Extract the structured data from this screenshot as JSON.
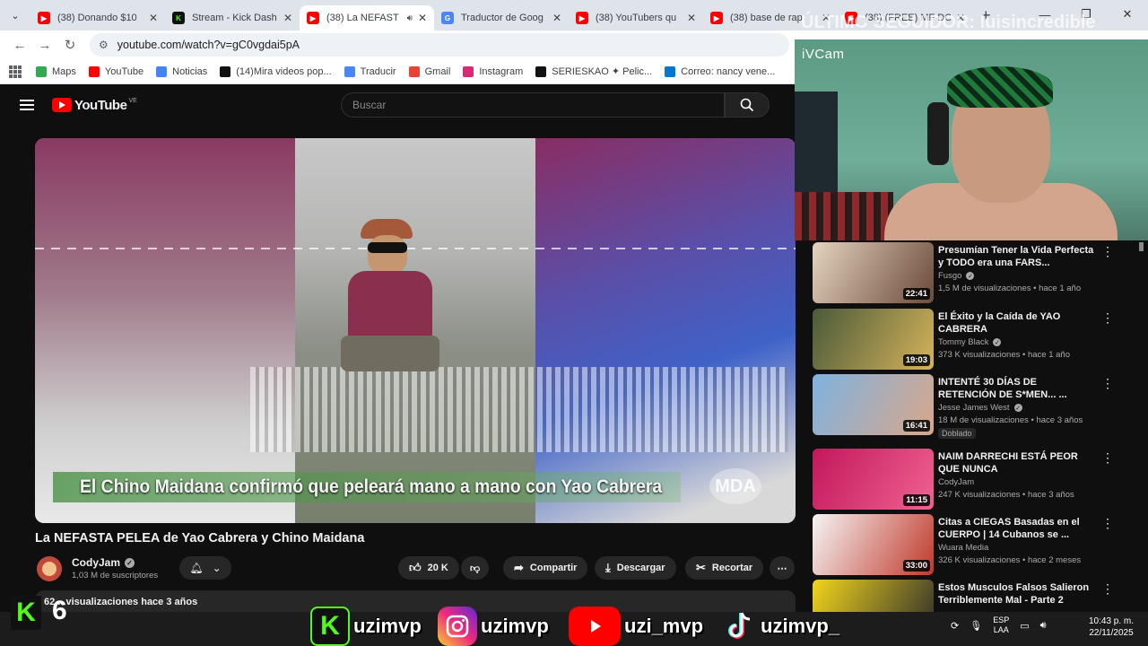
{
  "browser": {
    "tabs": [
      {
        "label": "(38) Donando $10",
        "icon": "youtube-icon",
        "active": false
      },
      {
        "label": "Stream - Kick Dash",
        "icon": "kick-icon",
        "active": false
      },
      {
        "label": "(38) La NEFAST",
        "icon": "youtube-icon",
        "active": true
      },
      {
        "label": "Traductor de Goog",
        "icon": "translate-icon",
        "active": false
      },
      {
        "label": "(38) YouTubers qu",
        "icon": "youtube-icon",
        "active": false
      },
      {
        "label": "(38) base de rap",
        "icon": "youtube-icon",
        "active": false
      },
      {
        "label": "(38) (FREE) MF DO",
        "icon": "youtube-icon",
        "active": false
      }
    ],
    "url": "youtube.com/watch?v=gC0vgdai5pA",
    "bookmarks": [
      {
        "label": "Maps",
        "color": "#34a853"
      },
      {
        "label": "YouTube",
        "color": "#ff0000"
      },
      {
        "label": "Noticias",
        "color": "#4285f4"
      },
      {
        "label": "(14)Mira videos pop...",
        "color": "#111111"
      },
      {
        "label": "Traducir",
        "color": "#4a86f7"
      },
      {
        "label": "Gmail",
        "color": "#ea4335"
      },
      {
        "label": "Instagram",
        "color": "#d62976"
      },
      {
        "label": "SERIESKAO ✦ Pelic...",
        "color": "#111111"
      },
      {
        "label": "Correo: nancy vene...",
        "color": "#0078d4"
      }
    ]
  },
  "youtube": {
    "logo": "YouTube",
    "country": "VE",
    "search_placeholder": "Buscar",
    "video": {
      "caption": "El Chino Maidana confirmó que peleará mano a mano con Yao Cabrera",
      "watermark": "MDA",
      "title": "La NEFASTA PELEA de Yao Cabrera y Chino Maidana"
    },
    "channel": {
      "name": "CodyJam",
      "subscribers": "1,03 M de suscriptores"
    },
    "actions": {
      "likes": "20 K",
      "share": "Compartir",
      "download": "Descargar",
      "clip": "Recortar",
      "more": "⋯"
    },
    "description": {
      "stats": "62... visualizaciones  hace 3 años"
    },
    "recommendations": [
      {
        "title": "Presumían Tener la Vida Perfecta y TODO era una FARS...",
        "channel": "Fusgo",
        "verified": true,
        "meta": "1,5 M de visualizaciones • hace 1 año",
        "duration": "22:41",
        "colors": [
          "#e5d3c0",
          "#6b4a3a"
        ],
        "badge": ""
      },
      {
        "title": "El Éxito y la Caída de YAO CABRERA",
        "channel": "Tommy Black",
        "verified": true,
        "meta": "373 K visualizaciones • hace 1 año",
        "duration": "19:03",
        "colors": [
          "#4a5a3a",
          "#d5b35a"
        ],
        "badge": ""
      },
      {
        "title": "INTENTÉ 30 DÍAS DE RETENCIÓN DE S*MEN... ...",
        "channel": "Jesse James West",
        "verified": true,
        "meta": "18 M de visualizaciones • hace 3 años",
        "duration": "16:41",
        "colors": [
          "#7fb2e0",
          "#d9a78a"
        ],
        "badge": "Doblado"
      },
      {
        "title": "NAIM DARRECHI ESTÁ PEOR QUE NUNCA",
        "channel": "CodyJam",
        "verified": false,
        "meta": "247 K visualizaciones • hace 3 años",
        "duration": "11:15",
        "colors": [
          "#c2185b",
          "#f06292"
        ],
        "badge": ""
      },
      {
        "title": "Citas a CIEGAS Basadas en el CUERPO | 14 Cubanos se ...",
        "channel": "Wuara Media",
        "verified": false,
        "meta": "326 K visualizaciones • hace 2 meses",
        "duration": "33:00",
        "colors": [
          "#f5f5f5",
          "#c0392b"
        ],
        "badge": ""
      },
      {
        "title": "Estos Musculos Falsos Salieron Terriblemente Mal - Parte 2",
        "channel": "",
        "verified": false,
        "meta": "",
        "duration": "",
        "colors": [
          "#f2d51b",
          "#2c2c2c"
        ],
        "badge": ""
      }
    ]
  },
  "overlay": {
    "cam_title": "iVCam",
    "last_follower": "ÚLTIMO SEGUIDOR: luisincredible",
    "kick_count": "6",
    "socials": [
      {
        "name": "uzimvp",
        "icon": "kick-icon"
      },
      {
        "name": "uzimvp",
        "icon": "instagram-icon"
      },
      {
        "name": "uzi_mvp",
        "icon": "youtube-icon"
      },
      {
        "name": "uzimvp_",
        "icon": "tiktok-icon"
      }
    ]
  },
  "taskbar": {
    "lang_top": "ESP",
    "lang_bottom": "LAA",
    "time": "10:43 p. m.",
    "date": "22/11/2025"
  }
}
